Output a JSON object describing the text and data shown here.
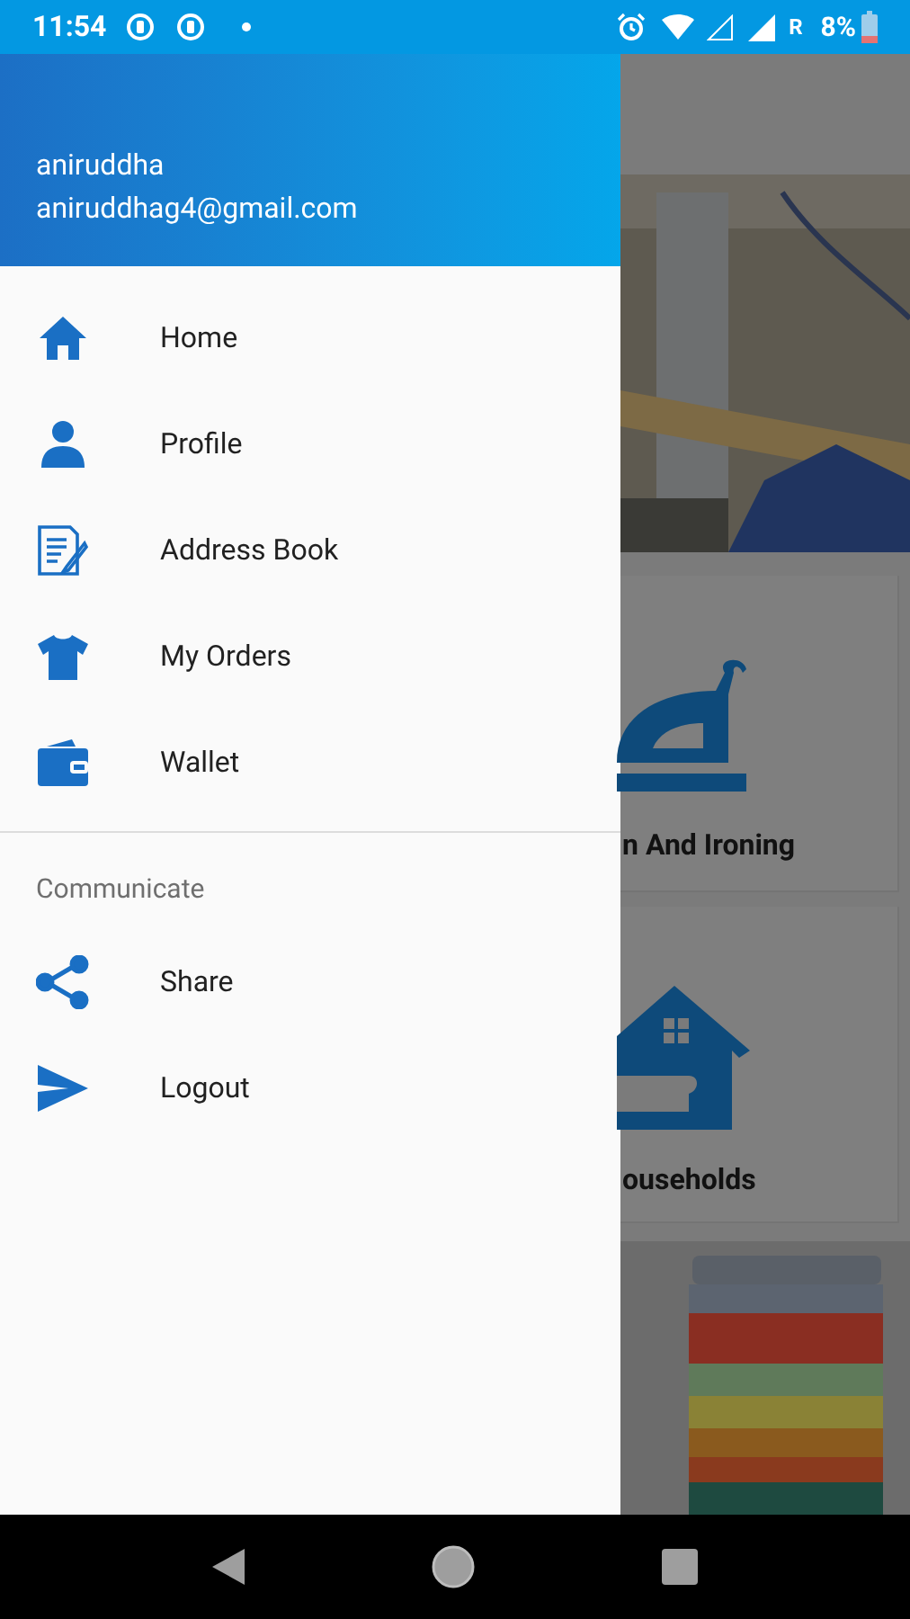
{
  "status_bar": {
    "time": "11:54",
    "network": "R",
    "battery": "8%"
  },
  "drawer": {
    "user_name": "aniruddha",
    "email": "aniruddhag4@gmail.com",
    "items": [
      {
        "label": "Home"
      },
      {
        "label": "Profile"
      },
      {
        "label": "Address Book"
      },
      {
        "label": "My Orders"
      },
      {
        "label": "Wallet"
      }
    ],
    "section_title": "Communicate",
    "section_items": [
      {
        "label": "Share"
      },
      {
        "label": "Logout"
      }
    ]
  },
  "background": {
    "cards": [
      {
        "label": "n And Ironing"
      },
      {
        "label": "ouseholds"
      }
    ]
  }
}
